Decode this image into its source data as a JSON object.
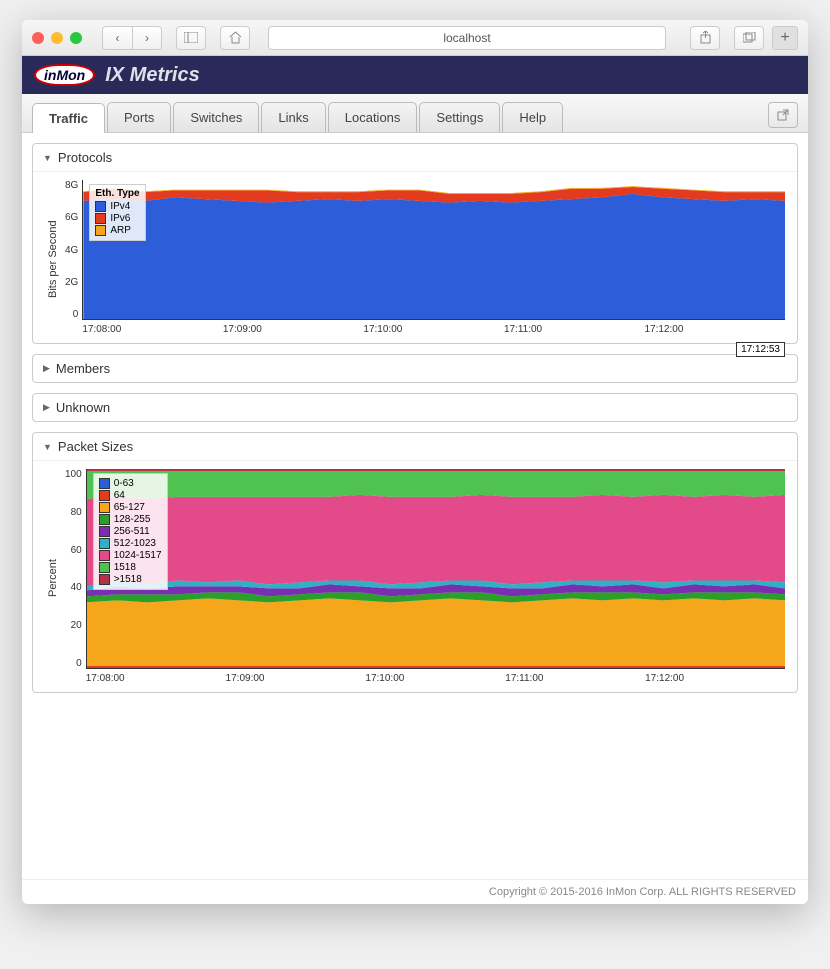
{
  "browser": {
    "address": "localhost"
  },
  "app": {
    "logo_text": "inMon",
    "title": "IX Metrics"
  },
  "tabs": [
    "Traffic",
    "Ports",
    "Switches",
    "Links",
    "Locations",
    "Settings",
    "Help"
  ],
  "active_tab": 0,
  "panels": {
    "protocols": {
      "title": "Protocols",
      "expanded": true
    },
    "members": {
      "title": "Members",
      "expanded": false
    },
    "unknown": {
      "title": "Unknown",
      "expanded": false
    },
    "packet_sizes": {
      "title": "Packet Sizes",
      "expanded": true
    }
  },
  "chart_data": [
    {
      "id": "protocols",
      "type": "area",
      "title": "",
      "ylabel": "Bits per Second",
      "xlabel": "",
      "ylim": [
        0,
        8
      ],
      "y_unit": "G",
      "y_ticks": [
        "0",
        "2G",
        "4G",
        "6G",
        "8G"
      ],
      "x_ticks": [
        "17:08:00",
        "17:09:00",
        "17:10:00",
        "17:11:00",
        "17:12:00"
      ],
      "cursor_time": "17:12:53",
      "legend_title": "Eth. Type",
      "series": [
        {
          "name": "IPv4",
          "color": "#2d5dd8",
          "values": [
            6.8,
            6.9,
            6.8,
            7.0,
            6.9,
            6.8,
            6.7,
            6.8,
            6.9,
            6.8,
            6.9,
            6.8,
            6.7,
            6.8,
            6.7,
            6.8,
            6.9,
            7.0,
            7.2,
            7.0,
            6.9,
            6.8,
            6.9,
            6.8
          ]
        },
        {
          "name": "IPv6",
          "color": "#e23b1f",
          "values": [
            0.5,
            0.6,
            0.5,
            0.4,
            0.5,
            0.6,
            0.7,
            0.5,
            0.4,
            0.5,
            0.5,
            0.6,
            0.5,
            0.4,
            0.5,
            0.5,
            0.6,
            0.5,
            0.4,
            0.5,
            0.5,
            0.5,
            0.4,
            0.5
          ]
        },
        {
          "name": "ARP",
          "color": "#f5a61b",
          "values": [
            0.05,
            0.05,
            0.05,
            0.05,
            0.05,
            0.05,
            0.05,
            0.05,
            0.05,
            0.05,
            0.05,
            0.05,
            0.05,
            0.05,
            0.05,
            0.05,
            0.05,
            0.05,
            0.05,
            0.05,
            0.05,
            0.05,
            0.05,
            0.05
          ]
        }
      ]
    },
    {
      "id": "packet_sizes",
      "type": "area",
      "title": "",
      "ylabel": "Percent",
      "xlabel": "",
      "ylim": [
        0,
        100
      ],
      "y_ticks": [
        "0",
        "20",
        "40",
        "60",
        "80",
        "100"
      ],
      "x_ticks": [
        "17:08:00",
        "17:09:00",
        "17:10:00",
        "17:11:00",
        "17:12:00"
      ],
      "legend_title": "",
      "series": [
        {
          "name": "0-63",
          "color": "#2d5dd8",
          "values": [
            0,
            0,
            0,
            0,
            0,
            0,
            0,
            0,
            0,
            0,
            0,
            0,
            0,
            0,
            0,
            0,
            0,
            0,
            0,
            0,
            0,
            0,
            0,
            0
          ]
        },
        {
          "name": "64",
          "color": "#e23b1f",
          "values": [
            1,
            1,
            1,
            1,
            1,
            1,
            1,
            1,
            1,
            1,
            1,
            1,
            1,
            1,
            1,
            1,
            1,
            1,
            1,
            1,
            1,
            1,
            1,
            1
          ]
        },
        {
          "name": "65-127",
          "color": "#f5a61b",
          "values": [
            32,
            33,
            32,
            33,
            34,
            33,
            32,
            33,
            34,
            33,
            32,
            33,
            34,
            33,
            32,
            33,
            34,
            33,
            34,
            33,
            34,
            33,
            34,
            33
          ]
        },
        {
          "name": "128-255",
          "color": "#2aa02a",
          "values": [
            3,
            3,
            4,
            3,
            3,
            4,
            3,
            3,
            3,
            4,
            3,
            3,
            3,
            4,
            3,
            3,
            3,
            4,
            3,
            3,
            3,
            4,
            3,
            3
          ]
        },
        {
          "name": "256-511",
          "color": "#7a2fb0",
          "values": [
            3,
            4,
            3,
            4,
            3,
            3,
            4,
            3,
            4,
            3,
            4,
            3,
            4,
            3,
            4,
            3,
            4,
            3,
            4,
            3,
            4,
            3,
            4,
            3
          ]
        },
        {
          "name": "512-1023",
          "color": "#2fb0c4",
          "values": [
            2,
            3,
            2,
            3,
            2,
            3,
            2,
            3,
            2,
            3,
            2,
            3,
            2,
            3,
            2,
            3,
            2,
            3,
            2,
            3,
            2,
            3,
            2,
            3
          ]
        },
        {
          "name": "1024-1517",
          "color": "#e24a8a",
          "values": [
            44,
            42,
            43,
            42,
            43,
            42,
            44,
            43,
            42,
            43,
            44,
            43,
            42,
            43,
            44,
            43,
            42,
            43,
            42,
            44,
            42,
            43,
            42,
            44
          ]
        },
        {
          "name": "1518",
          "color": "#4fc24f",
          "values": [
            14,
            13,
            14,
            13,
            13,
            13,
            13,
            13,
            13,
            12,
            13,
            13,
            13,
            12,
            13,
            13,
            13,
            12,
            13,
            12,
            13,
            12,
            13,
            12
          ]
        },
        {
          "name": ">1518",
          "color": "#b5304a",
          "values": [
            1,
            1,
            1,
            1,
            1,
            1,
            1,
            1,
            1,
            1,
            1,
            1,
            1,
            1,
            1,
            1,
            1,
            1,
            1,
            1,
            1,
            1,
            1,
            1
          ]
        }
      ]
    }
  ],
  "footer": "Copyright © 2015-2016 InMon Corp. ALL RIGHTS RESERVED"
}
